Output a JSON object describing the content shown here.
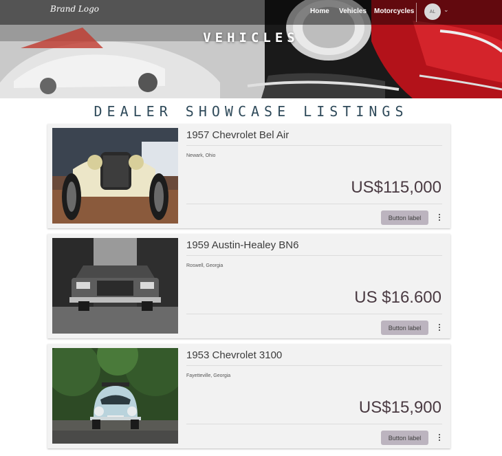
{
  "header": {
    "brand": "Brand Logo",
    "nav": [
      "Home",
      "Vehicles",
      "Motorcycles"
    ],
    "avatar_initials": "AL",
    "hero_title": "VEHICLES"
  },
  "section_title": "DEALER SHOWCASE LISTINGS",
  "listings": [
    {
      "title": "1957 Chevrolet Bel Air",
      "location": "Newark, Ohio",
      "price": "US$115,000",
      "button": "Button label"
    },
    {
      "title": "1959 Austin-Healey BN6",
      "location": "Roswell, Georgia",
      "price": "US $16.600",
      "button": "Button label"
    },
    {
      "title": "1953 Chevrolet 3100",
      "location": "Fayetteville, Georgia",
      "price": "US$15,900",
      "button": "Button label"
    }
  ],
  "colors": {
    "section_title": "#2f4a5a",
    "button_bg": "#bcb4bf",
    "price_text": "#4a3a42",
    "card_bg": "#f2f2f2"
  },
  "icons": {
    "avatar_caret": "chevron-down-icon",
    "card_menu": "more-vertical-icon"
  }
}
